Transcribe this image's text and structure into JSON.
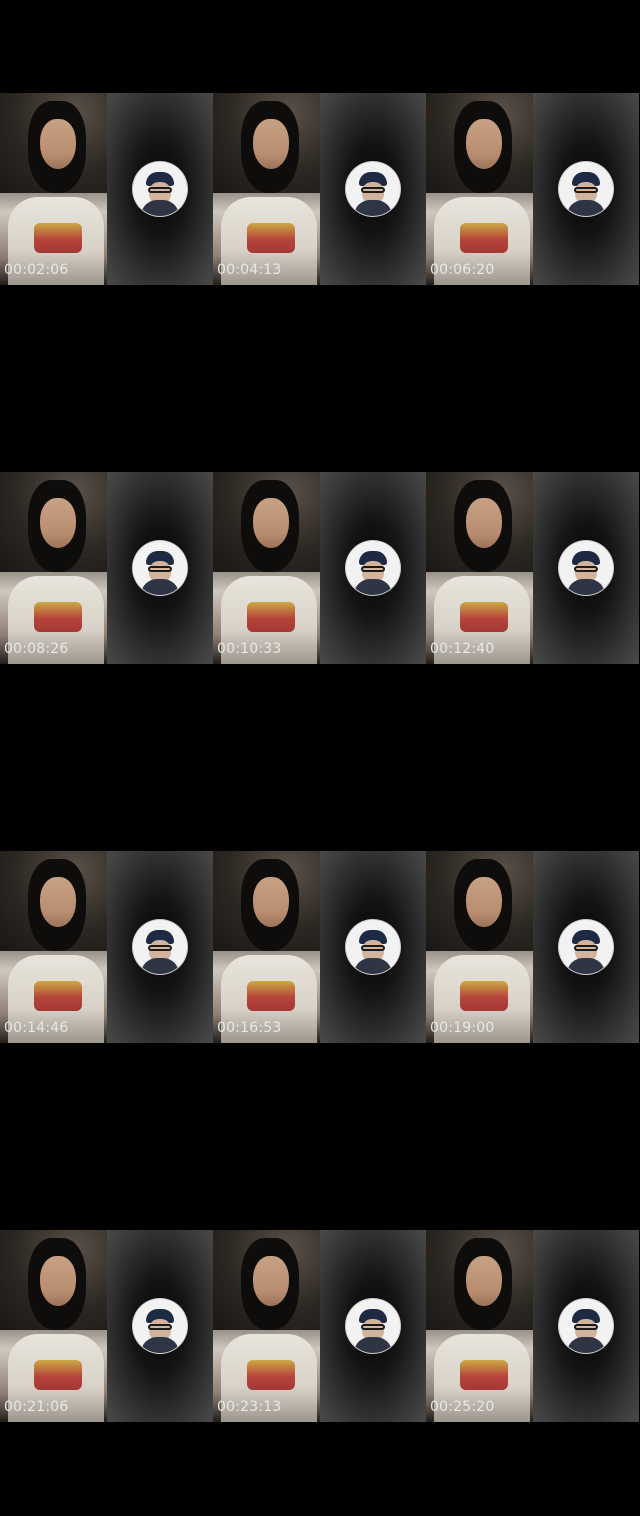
{
  "contact_sheet": {
    "frames": [
      {
        "timestamp": "00:02:06"
      },
      {
        "timestamp": "00:04:13"
      },
      {
        "timestamp": "00:06:20"
      },
      {
        "timestamp": "00:08:26"
      },
      {
        "timestamp": "00:10:33"
      },
      {
        "timestamp": "00:12:40"
      },
      {
        "timestamp": "00:14:46"
      },
      {
        "timestamp": "00:16:53"
      },
      {
        "timestamp": "00:19:00"
      },
      {
        "timestamp": "00:21:06"
      },
      {
        "timestamp": "00:23:13"
      },
      {
        "timestamp": "00:25:20"
      }
    ]
  }
}
